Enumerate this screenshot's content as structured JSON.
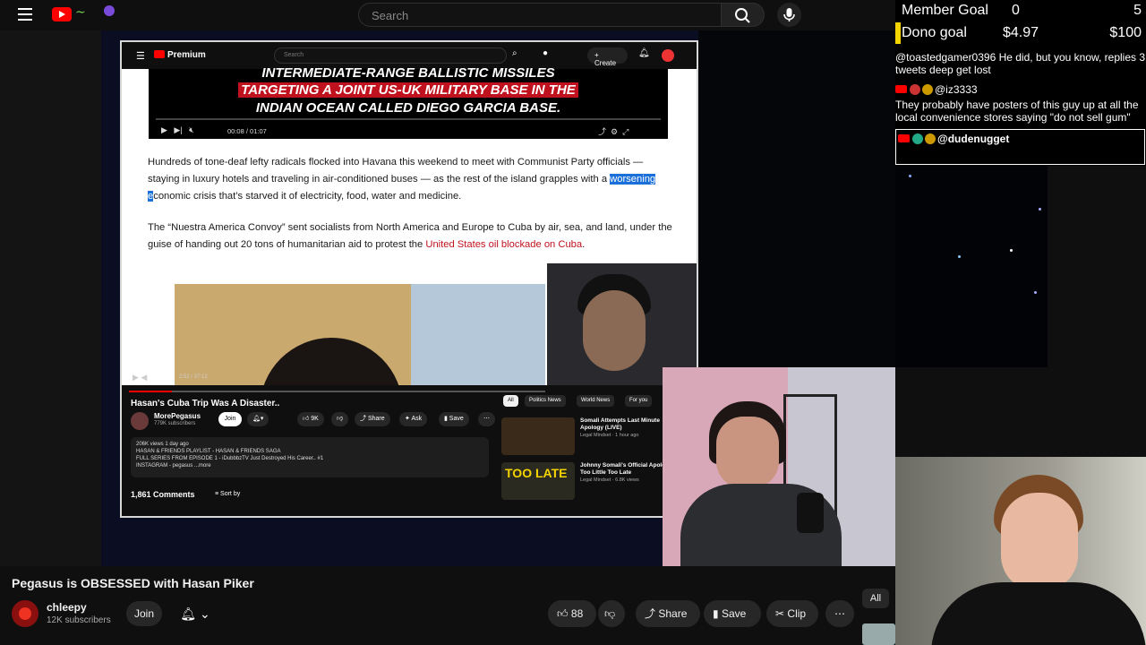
{
  "topbar": {
    "search_placeholder": "Search"
  },
  "inner": {
    "search_placeholder": "Search",
    "logo_label": "Premium",
    "create_label": "Create",
    "banner_lines": [
      "INTERMEDIATE-RANGE BALLISTIC MISSILES",
      "TARGETING A JOINT US-UK MILITARY BASE IN THE",
      "INDIAN OCEAN CALLED DIEGO GARCIA BASE."
    ],
    "video_time": "00:08 / 01:07",
    "article_p1_a": "Hundreds of tone-deaf lefty radicals flocked into Havana this weekend to meet with Communist Party officials — staying in luxury hotels and traveling in air-conditioned buses — as the rest of the island grapples with a ",
    "article_p1_hl": "worsening e",
    "article_p1_b": "conomic crisis that’s starved it of electricity, food, water and medicine.",
    "article_p2_a": "The “Nuestra America Convoy” sent socialists from North America and Europe to Cuba by air, sea, and land, under the guise of handing out 20 tons of humanitarian aid to protest the ",
    "article_p2_link": "United States oil blockade on Cuba",
    "article_p2_b": ".",
    "yt": {
      "time": "2:52 / 37:12",
      "title": "Hasan's Cuba Trip Was A Disaster..",
      "channel": "MorePegasus",
      "subs": "779K subscribers",
      "join": "Join",
      "likes": "9K",
      "share": "Share",
      "ask": "Ask",
      "save": "Save",
      "desc_line1": "206K views  1 day ago",
      "desc_line2": "HASAN & FRIENDS PLAYLIST -   HASAN & FRIENDS SAGA",
      "desc_line3": "FULL SERIES FROM EPISODE 1 -   iDubbbzTV Just Destroyed His Career.. #1",
      "desc_line4": "INSTAGRAM -   pegasus",
      "desc_more": "...more",
      "comments": "1,861 Comments",
      "sort": "Sort by",
      "chips": [
        "All",
        "Politics News",
        "World News",
        "For you"
      ],
      "recs": [
        {
          "title": "Somali Attempts Last Minute Apology (LIVE)",
          "meta": "Legal Mindset · 1 hour ago"
        },
        {
          "title": "Johnny Somali's Official Apology: Too Little Too Late",
          "meta": "Legal Mindset · 6.8K views"
        }
      ],
      "rec_thumb_text": "TOO LATE"
    }
  },
  "overlay": {
    "member_goal_label": "Member Goal",
    "member_goal_current": "0",
    "member_goal_target": "5",
    "dono_goal_label": "Dono goal",
    "dono_goal_current": "$4.97",
    "dono_goal_target": "$100",
    "chat": [
      {
        "text": "@toastedgamer0396 He did, but you know, replies 3 tweets deep get lost"
      },
      {
        "user": "@iz3333",
        "text": "They probably have posters of this guy up at all the local convenience stores saying \"do not sell gum\""
      },
      {
        "user": "@dudenugget"
      }
    ]
  },
  "video": {
    "title": "Pegasus is OBSESSED with Hasan Piker",
    "channel": "chleepy",
    "subs": "12K subscribers",
    "join": "Join",
    "likes": "88",
    "share": "Share",
    "save": "Save",
    "clip": "Clip",
    "all_chip": "All"
  },
  "colors": {
    "youtube_red": "#ff0000",
    "highlight_blue": "#1a6fd9",
    "goal_yellow": "#f5d400",
    "link_red": "#c0121e"
  }
}
